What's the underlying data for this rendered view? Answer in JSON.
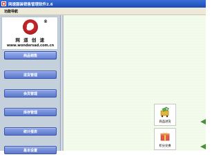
{
  "window": {
    "title": "网速服装销售管理软件2.6"
  },
  "menubar": {
    "items": [
      "功能导航"
    ]
  },
  "logo": {
    "mark_letter": "e",
    "reg_mark": "®",
    "brand_text": "网 道 创 速",
    "url": "www.wondersad.com.cn"
  },
  "sidebar": {
    "items": [
      {
        "label": "商品销售"
      },
      {
        "label": "进货管理"
      },
      {
        "label": "会员管理"
      },
      {
        "label": "库存管理"
      },
      {
        "label": "统计报表"
      },
      {
        "label": "基本设置"
      }
    ]
  },
  "main": {
    "tiles": [
      {
        "label": "商品进货",
        "icon": "shopping-cart-icon"
      },
      {
        "label": "积分兑换",
        "icon": "gift-icon"
      }
    ]
  },
  "colors": {
    "titlebar": "#1c4bb8",
    "nav_button": "#5a78cc",
    "panel_bg": "#c4d1dc",
    "main_bg": "#f3fcec"
  }
}
